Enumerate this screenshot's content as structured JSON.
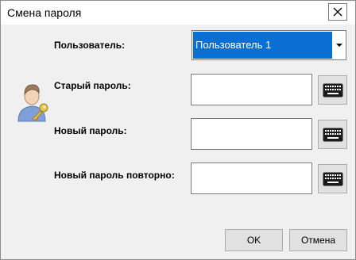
{
  "window": {
    "title": "Смена пароля"
  },
  "form": {
    "user_label": "Пользователь:",
    "user_selected": "Пользователь 1",
    "old_password_label": "Старый пароль:",
    "new_password_label": "Новый пароль:",
    "repeat_password_label": "Новый пароль повторно:"
  },
  "buttons": {
    "ok": "OK",
    "cancel": "Отмена"
  },
  "icons": {
    "close": "close-icon",
    "dropdown": "chevron-down-icon",
    "keyboard": "keyboard-icon",
    "user_key": "user-key-icon"
  },
  "colors": {
    "selection": "#0a6fd3",
    "window_bg": "#f0f0f0"
  }
}
